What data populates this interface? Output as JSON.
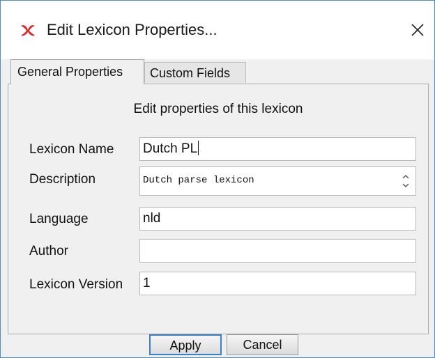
{
  "window": {
    "title": "Edit Lexicon Properties...",
    "app_icon": "app-logo-icon",
    "close_icon": "close-icon"
  },
  "tabs": [
    {
      "label": "General Properties",
      "active": true
    },
    {
      "label": "Custom Fields",
      "active": false
    }
  ],
  "form": {
    "heading": "Edit properties of this lexicon",
    "fields": [
      {
        "label": "Lexicon Name",
        "value": "Dutch PL"
      },
      {
        "label": "Description",
        "value": "Dutch parse lexicon"
      },
      {
        "label": "Language",
        "value": "nld"
      },
      {
        "label": "Author",
        "value": ""
      },
      {
        "label": "Lexicon Version",
        "value": "1"
      }
    ]
  },
  "buttons": {
    "apply": "Apply",
    "cancel": "Cancel"
  },
  "colors": {
    "window_border": "#4a90c8",
    "app_icon": "#d32f2f",
    "default_button_border": "#3c7fc4"
  }
}
